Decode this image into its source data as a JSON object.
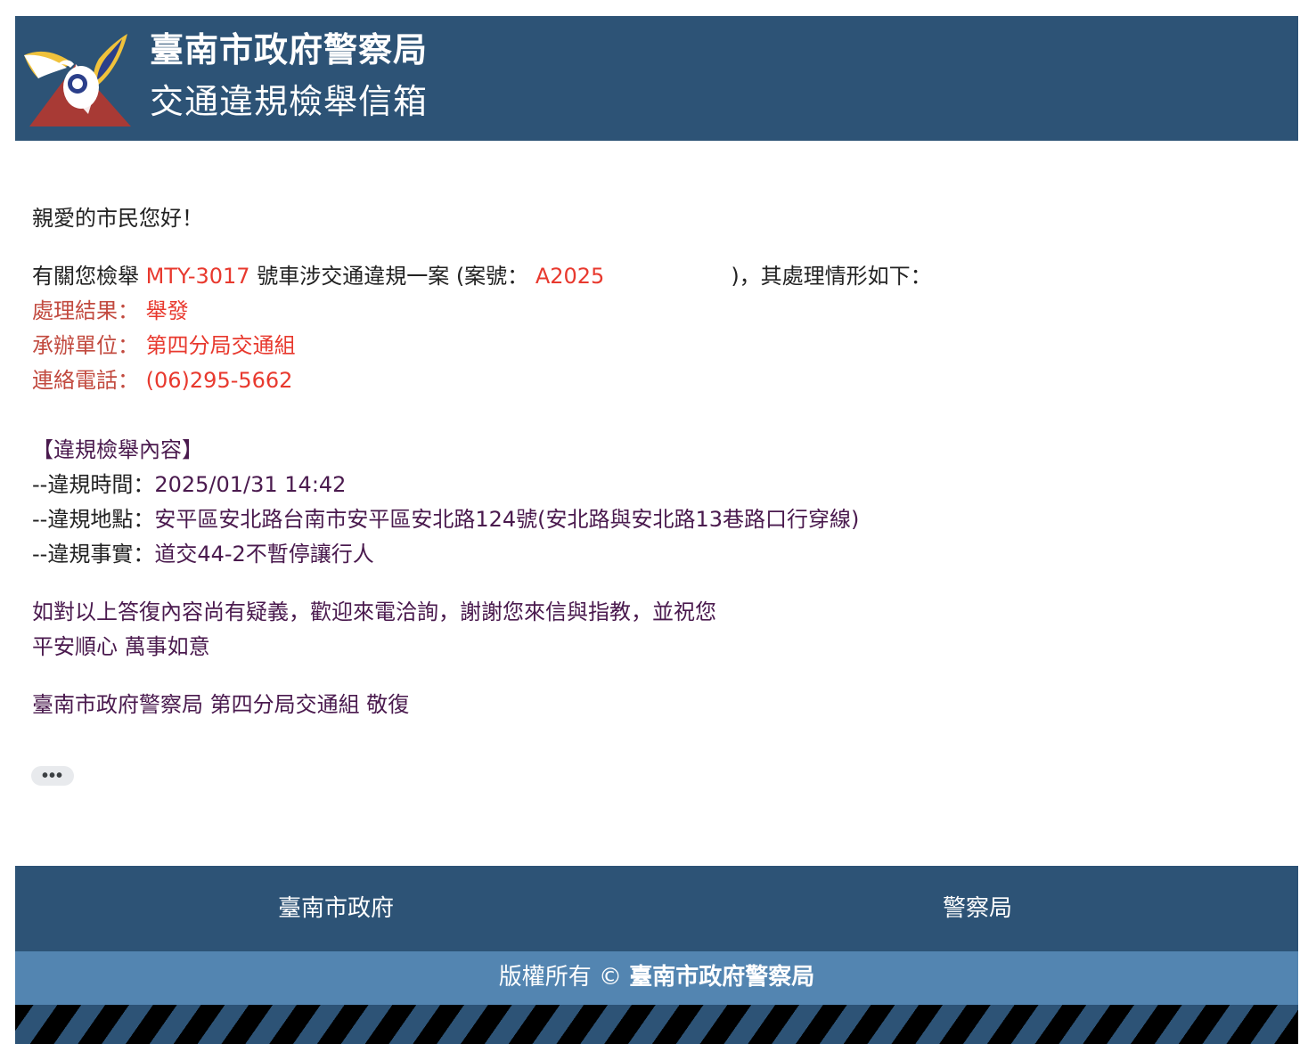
{
  "header": {
    "title": "臺南市政府警察局",
    "subtitle": "交通違規檢舉信箱"
  },
  "letter": {
    "greeting": "親愛的市民您好！",
    "intro_prefix": "有關您檢舉 ",
    "plate": "MTY-3017",
    "intro_mid": " 號車涉交通違規一案 (案號： ",
    "case_number": "A2025",
    "intro_suffix": ")，其處理情形如下：",
    "result_label": "處理結果：",
    "result_value": "舉發",
    "unit_label": "承辦單位：",
    "unit_value": "第四分局交通組",
    "phone_label": "連絡電話：",
    "phone_value": "(06)295-5662",
    "section_title": "【違規檢舉內容】",
    "time_label": "--違規時間：",
    "time_value": "2025/01/31 14:42",
    "location_label": "--違規地點：",
    "location_value": "安平區安北路台南市安平區安北路124號(安北路與安北路13巷路口行穿線)",
    "fact_label": "--違規事實：",
    "fact_value": "道交44-2不暫停讓行人",
    "closing_1": "如對以上答復內容尚有疑義，歡迎來電洽詢，謝謝您來信與指教，並祝您",
    "closing_2": "平安順心 萬事如意",
    "signature": "臺南市政府警察局 第四分局交通組 敬復",
    "more_label": "•••"
  },
  "footer": {
    "link_city": "臺南市政府",
    "link_police": "警察局",
    "copyright_prefix": "版權所有 © ",
    "copyright_owner": "臺南市政府警察局"
  },
  "colors": {
    "header_bg": "#2d5376",
    "copyright_bg": "#5385b1",
    "accent_red": "#e8392e",
    "text_purple": "#4a1a4e"
  }
}
